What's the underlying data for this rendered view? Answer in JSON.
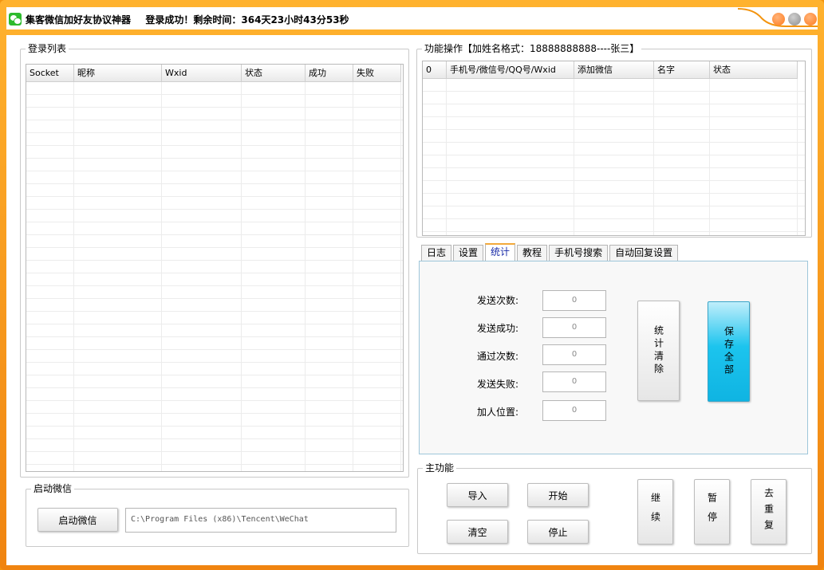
{
  "window": {
    "title": "集客微信加好友协议神器",
    "status": "登录成功！剩余时间：364天23小时43分53秒",
    "colors": {
      "frame": "#f3940f",
      "close": "#ff7b1c",
      "btn_gray": "#9a9a9a"
    }
  },
  "login_list": {
    "label": "登录列表",
    "columns": [
      "Socket",
      "昵称",
      "Wxid",
      "状态",
      "成功",
      "失败"
    ]
  },
  "function_ops": {
    "label": "功能操作【加姓名格式：18888888888----张三】",
    "columns": [
      "0",
      "手机号/微信号/QQ号/Wxid",
      "添加微信",
      "名字",
      "状态"
    ]
  },
  "tabs": [
    "日志",
    "设置",
    "统计",
    "教程",
    "手机号搜索",
    "自动回复设置"
  ],
  "active_tab": "统计",
  "stats": {
    "items": [
      {
        "label": "发送次数:",
        "value": "0"
      },
      {
        "label": "发送成功:",
        "value": "0"
      },
      {
        "label": "通过次数:",
        "value": "0"
      },
      {
        "label": "发送失败:",
        "value": "0"
      },
      {
        "label": "加人位置:",
        "value": "0"
      }
    ],
    "clear_label": "统计清除",
    "save_label": "保存全部",
    "save_color": "#1cc4ee"
  },
  "launch": {
    "label": "启动微信",
    "button_label": "启动微信",
    "path": "C:\\Program Files (x86)\\Tencent\\WeChat"
  },
  "main": {
    "label": "主功能",
    "import_label": "导入",
    "start_label": "开始",
    "clear_label": "清空",
    "stop_label": "停止",
    "continue_label": "继续",
    "pause_label": "暂停",
    "dedupe_label": "去重复"
  }
}
